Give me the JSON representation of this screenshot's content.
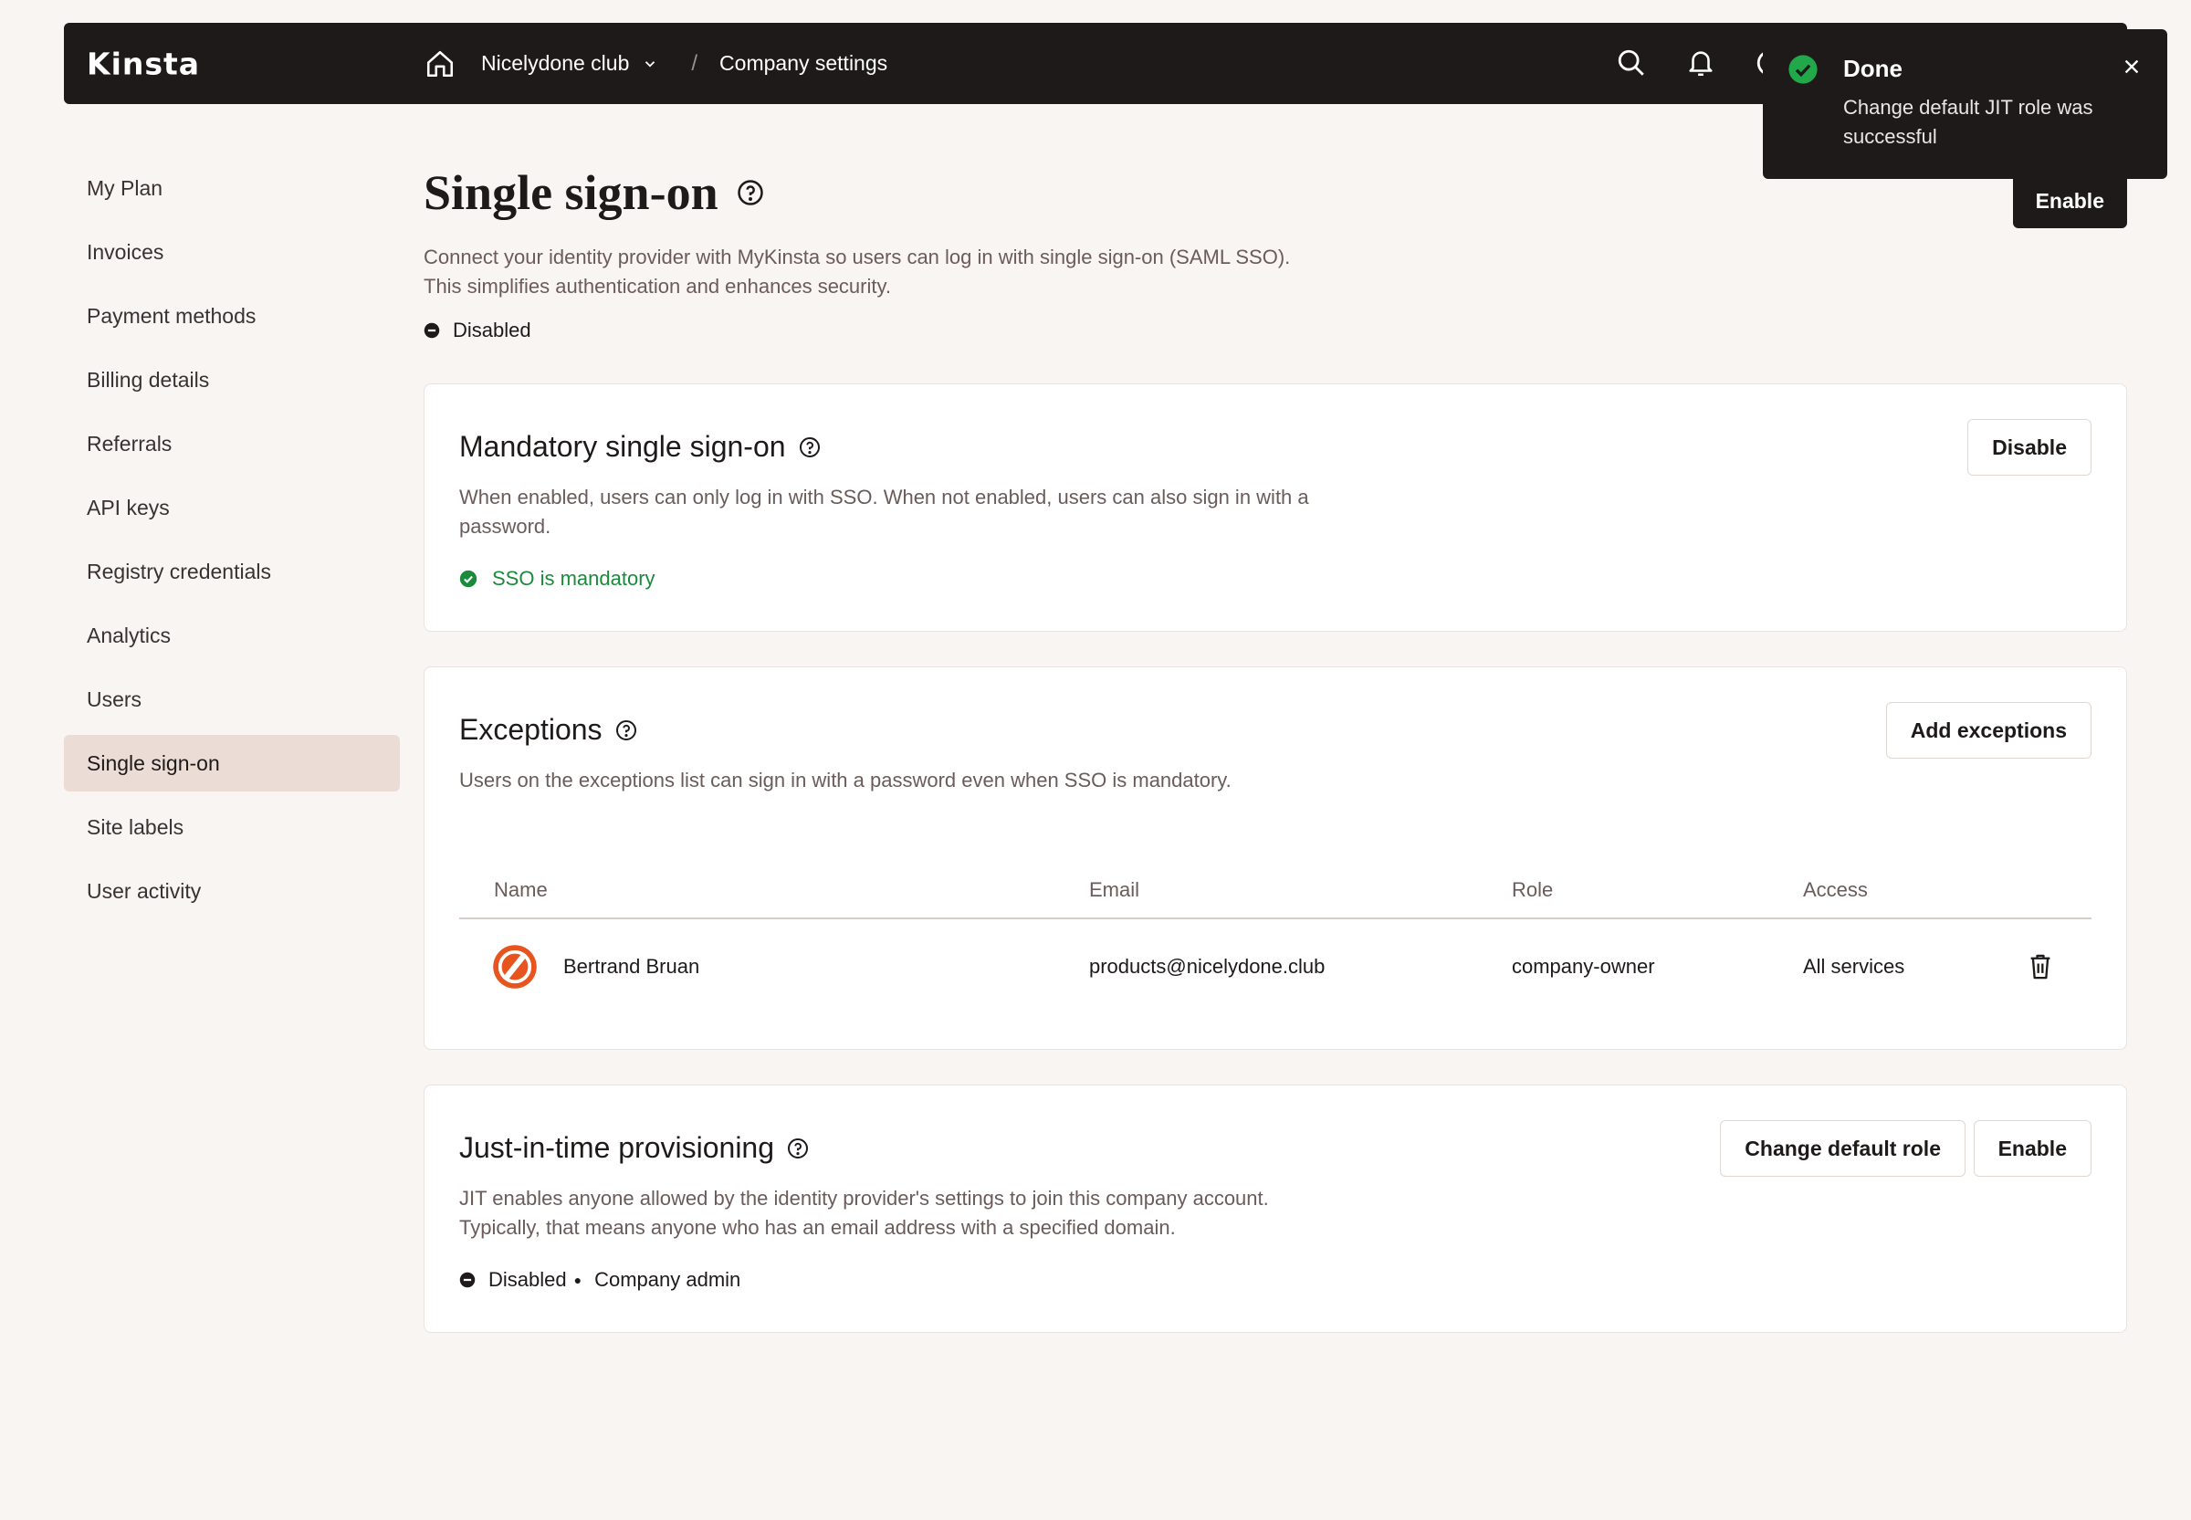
{
  "topbar": {
    "logo": "Kinsta",
    "company": "Nicelydone club",
    "separator": "/",
    "page": "Company settings"
  },
  "toast": {
    "title": "Done",
    "message": "Change default JIT role was successful"
  },
  "sidebar": {
    "items": [
      {
        "label": "My Plan"
      },
      {
        "label": "Invoices"
      },
      {
        "label": "Payment methods"
      },
      {
        "label": "Billing details"
      },
      {
        "label": "Referrals"
      },
      {
        "label": "API keys"
      },
      {
        "label": "Registry credentials"
      },
      {
        "label": "Analytics"
      },
      {
        "label": "Users"
      },
      {
        "label": "Single sign-on"
      },
      {
        "label": "Site labels"
      },
      {
        "label": "User activity"
      }
    ]
  },
  "sso": {
    "title": "Single sign-on",
    "enable_label": "Enable",
    "desc_line1": "Connect your identity provider with MyKinsta so users can log in with single sign-on (SAML SSO).",
    "desc_line2": "This simplifies authentication and enhances security.",
    "status": "Disabled"
  },
  "mandatory": {
    "title": "Mandatory single sign-on",
    "desc": "When enabled, users can only log in with SSO. When not enabled, users can also sign in with a password.",
    "status": "SSO is mandatory",
    "button": "Disable"
  },
  "exceptions": {
    "title": "Exceptions",
    "desc": "Users on the exceptions list can sign in with a password even when SSO is mandatory.",
    "button": "Add exceptions",
    "columns": {
      "name": "Name",
      "email": "Email",
      "role": "Role",
      "access": "Access"
    },
    "rows": [
      {
        "name": "Bertrand Bruan",
        "email": "products@nicelydone.club",
        "role": "company-owner",
        "access": "All services"
      }
    ]
  },
  "jit": {
    "title": "Just-in-time provisioning",
    "desc_line1": "JIT enables anyone allowed by the identity provider's settings to join this company account.",
    "desc_line2": "Typically, that means anyone who has an email address with a specified domain.",
    "status": "Disabled",
    "role": "Company admin",
    "change_button": "Change default role",
    "enable_button": "Enable"
  },
  "colors": {
    "topbar": "#1e1a1a",
    "background": "#f9f5f2",
    "success": "#1a8a3b",
    "active_nav": "#ebdcd6",
    "avatar": "#e8541e"
  }
}
